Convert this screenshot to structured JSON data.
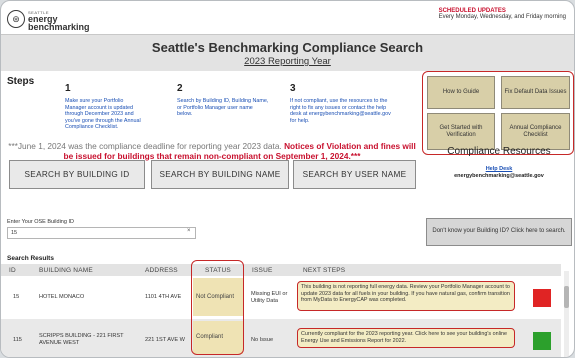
{
  "header": {
    "logo_small": "SEATTLE",
    "logo_line1": "energy",
    "logo_line2": "benchmarking",
    "sched_title": "SCHEDULED UPDATES",
    "sched_sub": "Every Monday, Wednesday, and Friday morning"
  },
  "title": {
    "main": "Seattle's Benchmarking Compliance Search",
    "sub": "2023 Reporting Year"
  },
  "steps": {
    "label": "Steps",
    "items": [
      {
        "num": "1",
        "text": "Make sure your Portfolio Manager account is updated through December 2023 and you've gone through the Annual Compliance Checklist."
      },
      {
        "num": "2",
        "text": "Search by Building ID, Building Name, or Portfolio Manager user name below."
      },
      {
        "num": "3",
        "text": "If not compliant, use the resources to the right to fix any issues or contact the help desk at energybenchmarking@seattle.gov for help."
      }
    ]
  },
  "resources": {
    "buttons": [
      "How to Guide",
      "Fix Default Data Issues",
      "Get Started with Verification",
      "Annual Compliance Checklist"
    ],
    "title": "Compliance Resources",
    "helpdesk_label": "Help Desk",
    "helpdesk_email": "energybenchmarking@seattle.gov"
  },
  "notice": {
    "plain": "***June 1, 2024 was the compliance deadline for reporting year 2023 data.",
    "red": "Notices of Violation and fines will be issued for buildings that remain non-compliant on September 1, 2024.***"
  },
  "search_buttons": [
    "SEARCH BY BUILDING ID",
    "SEARCH BY BUILDING NAME",
    "SEARCH BY USER NAME"
  ],
  "ose": {
    "label": "Enter Your OSE Building ID",
    "value": "15",
    "clear": "×"
  },
  "dont_know": "Don't know your Building ID? Click here to search.",
  "results": {
    "label": "Search Results",
    "columns": [
      "ID",
      "BUILDING NAME",
      "ADDRESS",
      "STATUS",
      "ISSUE",
      "NEXT STEPS"
    ],
    "rows": [
      {
        "id": "15",
        "name": "HOTEL MONACO",
        "address": "1101 4TH AVE",
        "status": "Not Compliant",
        "issue": "Missing EUI or Utility Data",
        "next": "This building is not reporting full energy data. Review your Portfolio Manager account to update 2023 data for all fuels in your building. If you have natural gas, confirm transition from MyData to EnergyCAP was completed.",
        "color": "#e02424"
      },
      {
        "id": "115",
        "name": "SCRIPPS BUILDING - 221 FIRST AVENUE WEST",
        "address": "221 1ST AVE W",
        "status": "Compliant",
        "issue": "No Issue",
        "next": "Currently compliant for the 2023 reporting year. Click here to see your building's online Energy Use and Emissions Report for 2022.",
        "color": "#2ca02c"
      }
    ]
  }
}
